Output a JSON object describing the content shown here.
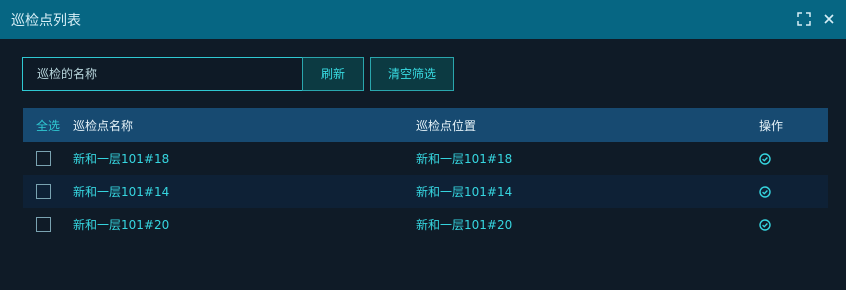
{
  "dialog": {
    "title": "巡检点列表"
  },
  "toolbar": {
    "search_placeholder": "巡检的名称",
    "refresh_label": "刷新",
    "clear_label": "清空筛选"
  },
  "table": {
    "select_all_label": "全选",
    "headers": {
      "name": "巡检点名称",
      "location": "巡检点位置",
      "action": "操作"
    },
    "rows": [
      {
        "name": "新和一层101#18",
        "location": "新和一层101#18",
        "action_icon": "check-circle-icon"
      },
      {
        "name": "新和一层101#14",
        "location": "新和一层101#14",
        "action_icon": "check-circle-icon"
      },
      {
        "name": "新和一层101#20",
        "location": "新和一层101#20",
        "action_icon": "check-circle-icon"
      }
    ]
  },
  "icons": {
    "fullscreen": "expand-icon",
    "close": "close-icon"
  },
  "colors": {
    "accent": "#2fc9d2",
    "titlebar": "#066683",
    "header_bg": "#174a71",
    "text_cyan": "#36d6e0"
  }
}
